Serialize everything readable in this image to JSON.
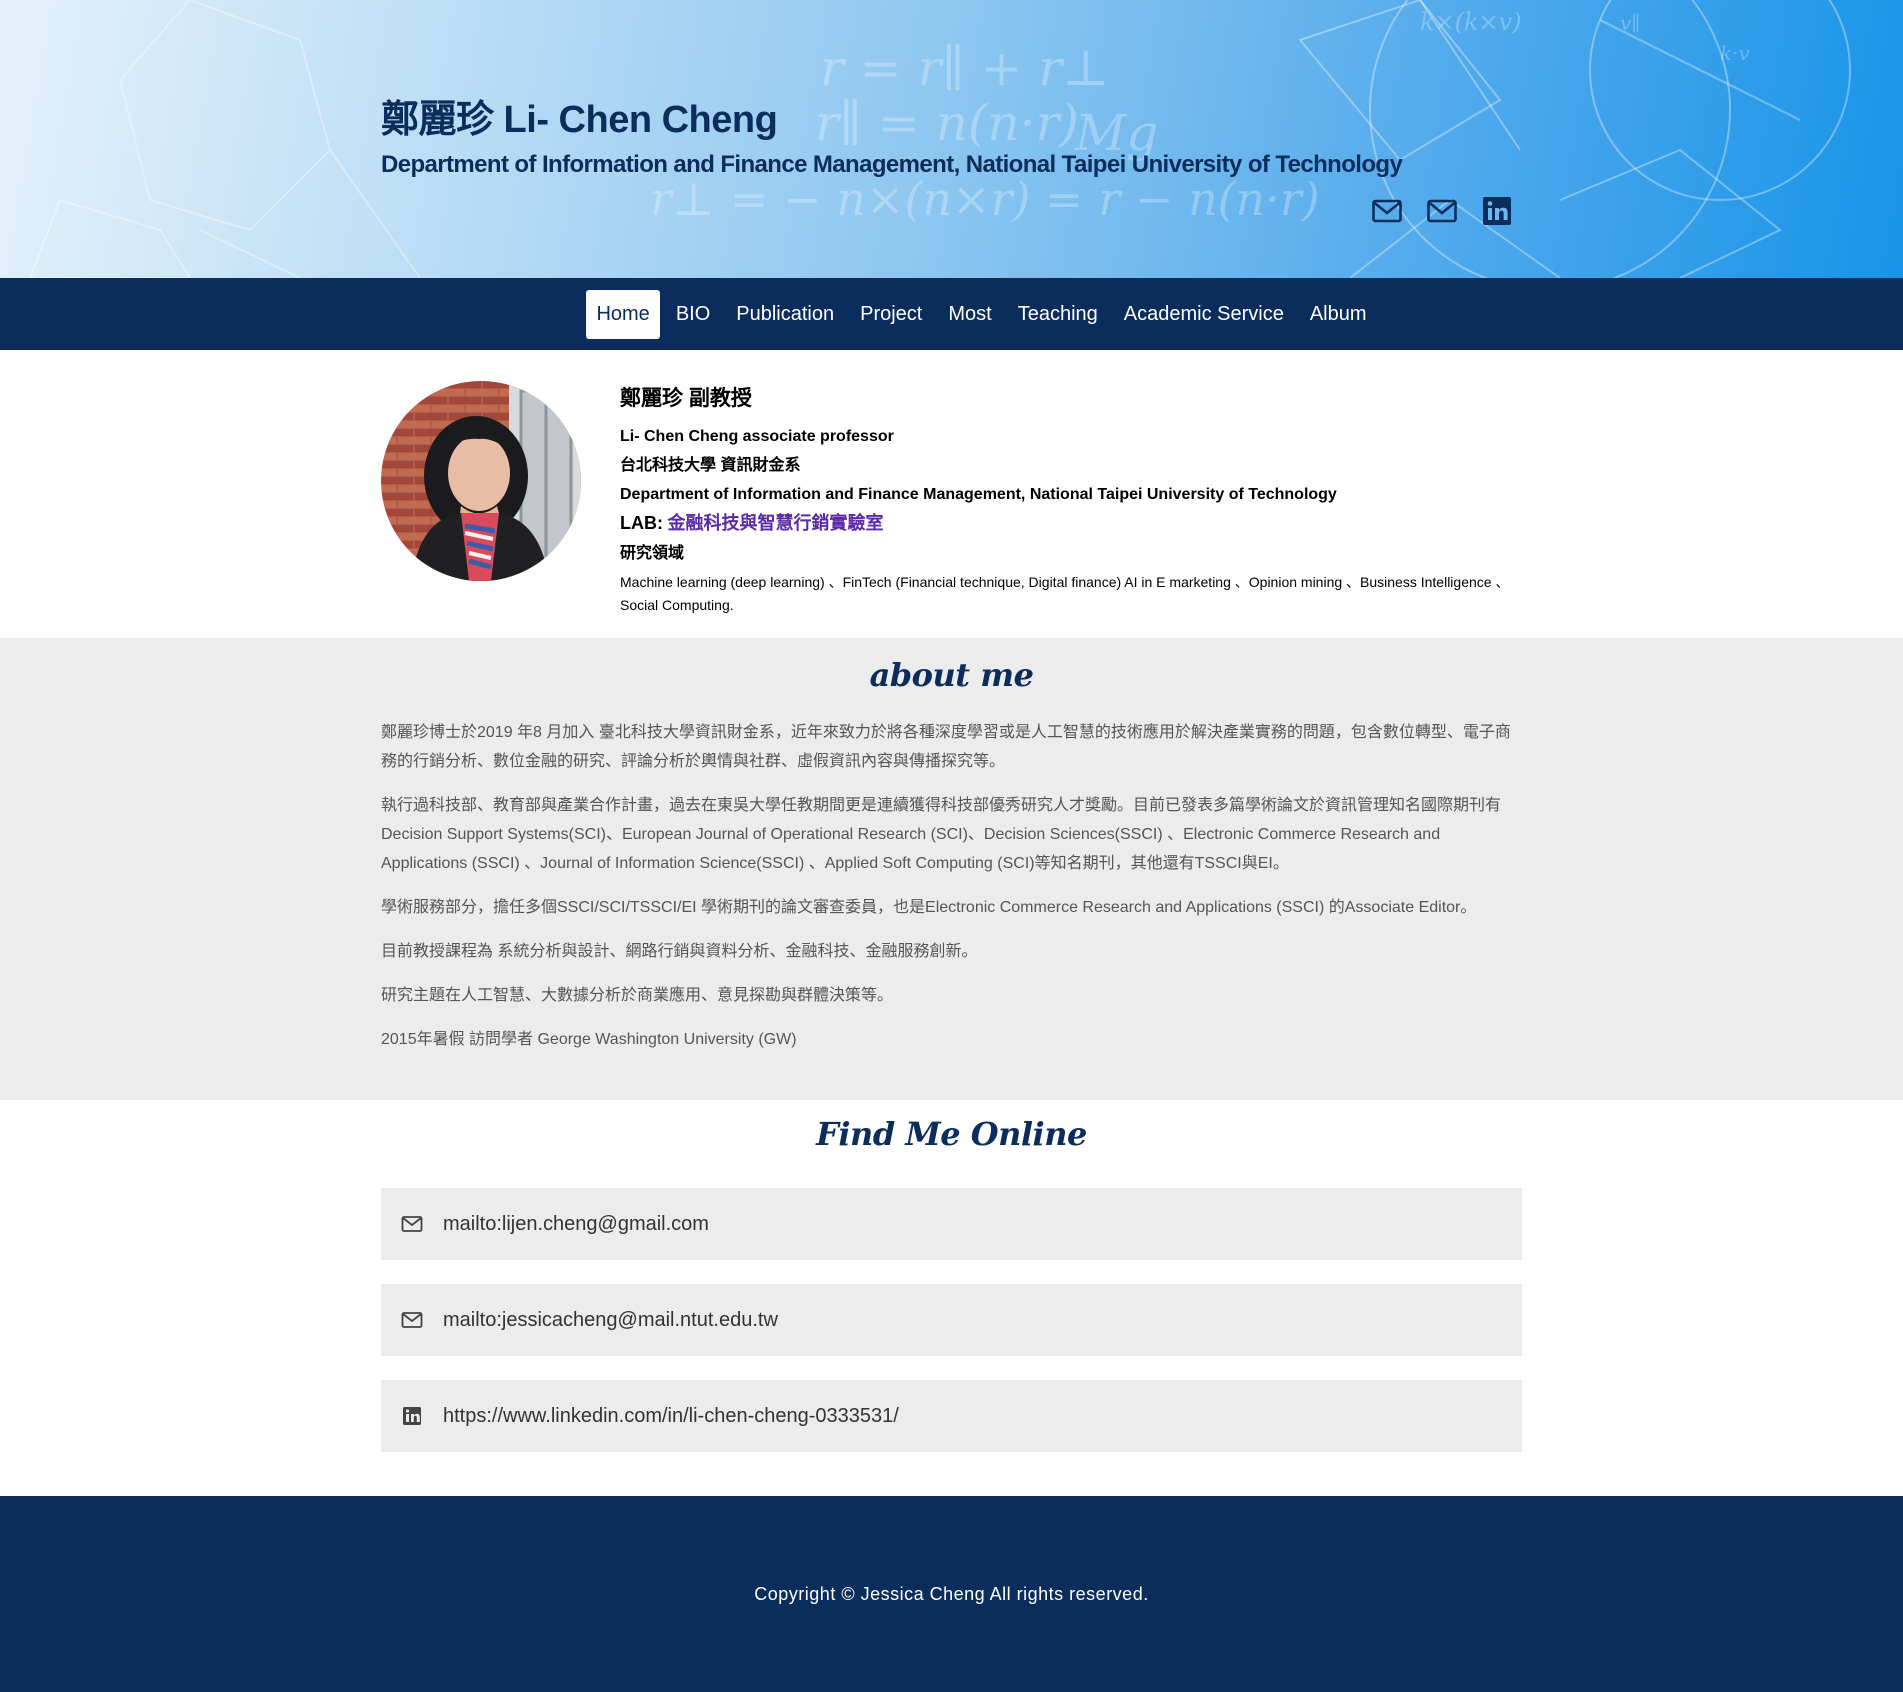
{
  "header": {
    "name": "鄭麗珍 Li- Chen Cheng",
    "department": "Department of Information and Finance Management, National Taipei University of Technology",
    "social_icons": [
      "mail-icon",
      "mail-icon",
      "linkedin-icon"
    ]
  },
  "nav": {
    "items": [
      "Home",
      "BIO",
      "Publication",
      "Project",
      "Most",
      "Teaching",
      "Academic Service",
      "Album"
    ],
    "active": "Home"
  },
  "profile": {
    "title_zh": "鄭麗珍 副教授",
    "title_en": "Li- Chen Cheng associate professor",
    "dept_zh": "台北科技大學 資訊財金系",
    "dept_en": "Department of Information and Finance Management, National Taipei University of Technology",
    "lab_label": "LAB:",
    "lab_name": "金融科技與智慧行銷實驗室",
    "research_label": "研究領域",
    "research_areas": "Machine learning (deep learning) 、FinTech (Financial technique, Digital finance) AI in E marketing 、Opinion mining 、Business Intelligence 、Social Computing."
  },
  "about": {
    "title": "about me",
    "paragraphs": [
      "鄭麗珍博士於2019 年8 月加入 臺北科技大學資訊財金系，近年來致力於將各種深度學習或是人工智慧的技術應用於解決產業實務的問題，包含數位轉型、電子商務的行銷分析、數位金融的研究、評論分析於輿情與社群、虛假資訊內容與傳播探究等。",
      "執行過科技部、教育部與產業合作計畫，過去在東吳大學任教期間更是連續獲得科技部優秀研究人才獎勵。目前已發表多篇學術論文於資訊管理知名國際期刊有Decision Support Systems(SCI)、European Journal of Operational Research (SCI)、Decision Sciences(SSCI) 、Electronic Commerce Research and Applications (SSCI) 、Journal of Information Science(SSCI) 、Applied Soft Computing (SCI)等知名期刊，其他還有TSSCI與EI。",
      "學術服務部分，擔任多個SSCI/SCI/TSSCI/EI 學術期刊的論文審查委員，也是Electronic Commerce Research and Applications (SSCI) 的Associate Editor。",
      "目前教授課程為 系統分析與設計、網路行銷與資料分析、金融科技、金融服務創新。",
      "研究主題在人工智慧、大數據分析於商業應用、意見探勘與群體決策等。",
      "2015年暑假 訪問學者 George Washington University (GW)"
    ]
  },
  "online": {
    "title": "Find Me Online",
    "items": [
      {
        "icon": "mail-icon",
        "text": "mailto:lijen.cheng@gmail.com"
      },
      {
        "icon": "mail-icon",
        "text": "mailto:jessicacheng@mail.ntut.edu.tw"
      },
      {
        "icon": "linkedin-icon",
        "text": "https://www.linkedin.com/in/li-chen-cheng-0333531/"
      }
    ]
  },
  "footer": {
    "copyright": "Copyright © Jessica Cheng All rights reserved."
  },
  "colors": {
    "navy": "#0b2d5b",
    "lab_link": "#5b2aa8",
    "section_bg": "#ececec"
  }
}
